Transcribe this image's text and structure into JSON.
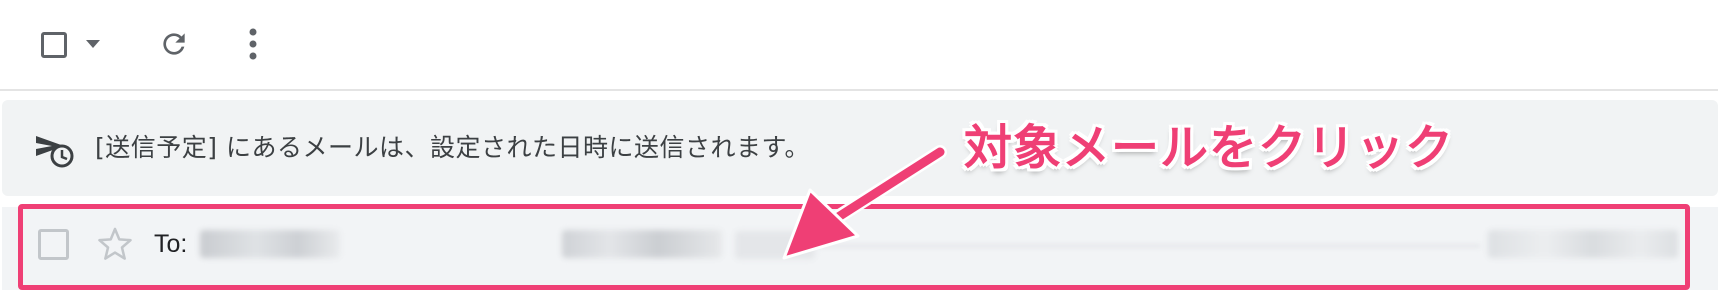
{
  "toolbar": {
    "select_icon": "checkbox-icon",
    "select_dropdown_icon": "caret-down-icon",
    "refresh_icon": "refresh-icon",
    "more_icon": "more-vertical-icon"
  },
  "banner": {
    "icon": "scheduled-send-icon",
    "text": "[送信予定] にあるメールは、設定された日時に送信されます。"
  },
  "email_row": {
    "to_label": "To:",
    "recipient": "",
    "subject": "",
    "snippet": ""
  },
  "annotation": {
    "text": "対象メールをクリック",
    "color": "#ef3f75"
  },
  "colors": {
    "accent": "#ef3f75",
    "icon_gray": "#5f6368",
    "banner_bg": "#f1f3f4"
  }
}
